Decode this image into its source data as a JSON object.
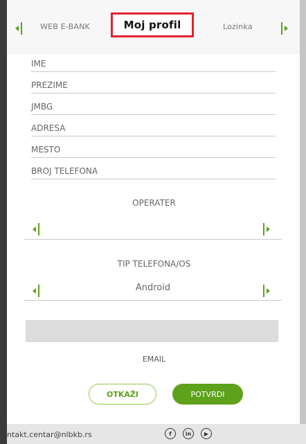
{
  "tabs": {
    "left": "WEB E-BANK",
    "active": "Moj profil",
    "right": "Lozinka"
  },
  "fields": [
    {
      "label": "IME"
    },
    {
      "label": "PREZIME"
    },
    {
      "label": "JMBG"
    },
    {
      "label": "ADRESA"
    },
    {
      "label": "MESTO"
    },
    {
      "label": "BROJ TELEFONA"
    }
  ],
  "operater": {
    "label": "OPERATER",
    "value": ""
  },
  "phone_type": {
    "label": "TIP TELEFONA/OS",
    "value": "Android"
  },
  "email": {
    "value": "",
    "label": "EMAIL"
  },
  "buttons": {
    "cancel": "OTKAŽI",
    "confirm": "POTVRDI"
  },
  "footer": {
    "contact_email": "ntakt.centar@nlbkb.rs",
    "social_icons": [
      "facebook-icon",
      "linkedin-icon",
      "youtube-icon"
    ]
  },
  "colors": {
    "accent_green": "#5ea11a",
    "active_tab_border": "#e5202e"
  }
}
